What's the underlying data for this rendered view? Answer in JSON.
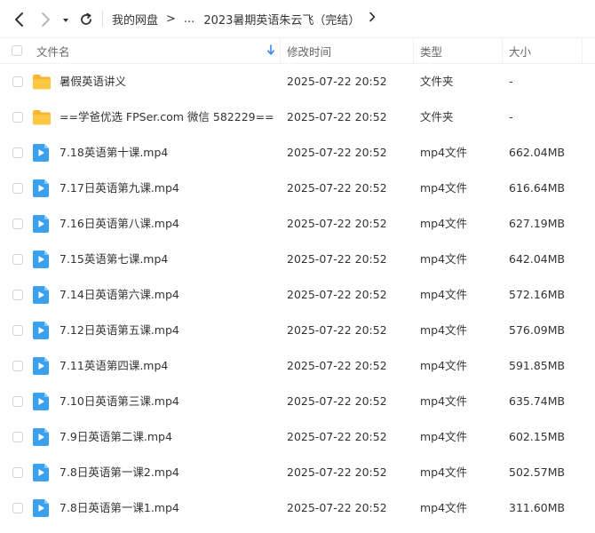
{
  "nav": {
    "icons": [
      "back-arrow-icon",
      "forward-arrow-icon",
      "dropdown-caret-icon",
      "refresh-icon"
    ]
  },
  "breadcrumb": {
    "root": "我的网盘",
    "sep": ">",
    "ellipsis": "...",
    "current": "2023暑期英语朱云飞（完结）"
  },
  "columns": {
    "name": "文件名",
    "modified": "修改时间",
    "type": "类型",
    "size": "大小"
  },
  "colors": {
    "folder": "#f7b733",
    "video": "#3aa0f0",
    "sort_arrow": "#3a86ff"
  },
  "files": [
    {
      "name": "暑假英语讲义",
      "modified": "2025-07-22 20:52",
      "type": "文件夹",
      "size": "-",
      "icon": "folder-icon"
    },
    {
      "name": "==学爸优选 FPSer.com 微信 582229==",
      "modified": "2025-07-22 20:52",
      "type": "文件夹",
      "size": "-",
      "icon": "folder-icon"
    },
    {
      "name": "7.18英语第十课.mp4",
      "modified": "2025-07-22 20:52",
      "type": "mp4文件",
      "size": "662.04MB",
      "icon": "video-file-icon"
    },
    {
      "name": "7.17日英语第九课.mp4",
      "modified": "2025-07-22 20:52",
      "type": "mp4文件",
      "size": "616.64MB",
      "icon": "video-file-icon"
    },
    {
      "name": "7.16日英语第八课.mp4",
      "modified": "2025-07-22 20:52",
      "type": "mp4文件",
      "size": "627.19MB",
      "icon": "video-file-icon"
    },
    {
      "name": "7.15英语第七课.mp4",
      "modified": "2025-07-22 20:52",
      "type": "mp4文件",
      "size": "642.04MB",
      "icon": "video-file-icon"
    },
    {
      "name": "7.14日英语第六课.mp4",
      "modified": "2025-07-22 20:52",
      "type": "mp4文件",
      "size": "572.16MB",
      "icon": "video-file-icon"
    },
    {
      "name": "7.12日英语第五课.mp4",
      "modified": "2025-07-22 20:52",
      "type": "mp4文件",
      "size": "576.09MB",
      "icon": "video-file-icon"
    },
    {
      "name": "7.11英语第四课.mp4",
      "modified": "2025-07-22 20:52",
      "type": "mp4文件",
      "size": "591.85MB",
      "icon": "video-file-icon"
    },
    {
      "name": "7.10日英语第三课.mp4",
      "modified": "2025-07-22 20:52",
      "type": "mp4文件",
      "size": "635.74MB",
      "icon": "video-file-icon"
    },
    {
      "name": "7.9日英语第二课.mp4",
      "modified": "2025-07-22 20:52",
      "type": "mp4文件",
      "size": "602.15MB",
      "icon": "video-file-icon"
    },
    {
      "name": "7.8日英语第一课2.mp4",
      "modified": "2025-07-22 20:52",
      "type": "mp4文件",
      "size": "502.57MB",
      "icon": "video-file-icon"
    },
    {
      "name": "7.8日英语第一课1.mp4",
      "modified": "2025-07-22 20:52",
      "type": "mp4文件",
      "size": "311.60MB",
      "icon": "video-file-icon"
    }
  ]
}
